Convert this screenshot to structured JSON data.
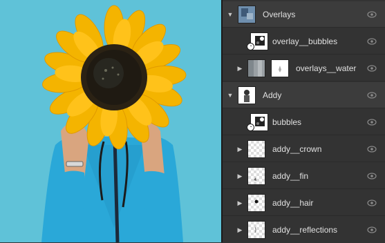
{
  "colors": {
    "canvas_background": "#5fc2d8",
    "panel_background": "#333333",
    "selected_row": "#3c3c3c",
    "label_text": "#e0e0e0"
  },
  "layers_panel": {
    "layers": [
      {
        "name": "Overlays",
        "type": "group",
        "expanded": true,
        "thumbnail": "overlays-group-thumb",
        "visible": true
      },
      {
        "name": "overlay__bubbles",
        "type": "linked-layer",
        "thumbnail": "bubbles-thumb",
        "visible": true
      },
      {
        "name": "overlays__water",
        "type": "group",
        "expanded": false,
        "thumbnail": "water-thumb",
        "has_mask": true,
        "visible": true
      },
      {
        "name": "Addy",
        "type": "group",
        "expanded": true,
        "thumbnail": "addy-group-thumb",
        "visible": true
      },
      {
        "name": "bubbles",
        "type": "linked-layer",
        "thumbnail": "bubbles-thumb",
        "visible": true
      },
      {
        "name": "addy__crown",
        "type": "group",
        "expanded": false,
        "thumbnail": "crown-thumb",
        "visible": true
      },
      {
        "name": "addy__fin",
        "type": "group",
        "expanded": false,
        "thumbnail": "fin-thumb",
        "visible": true
      },
      {
        "name": "addy__hair",
        "type": "group",
        "expanded": false,
        "thumbnail": "hair-thumb",
        "visible": true
      },
      {
        "name": "addy__reflections",
        "type": "group",
        "expanded": false,
        "thumbnail": "reflections-thumb",
        "visible": true
      }
    ]
  }
}
